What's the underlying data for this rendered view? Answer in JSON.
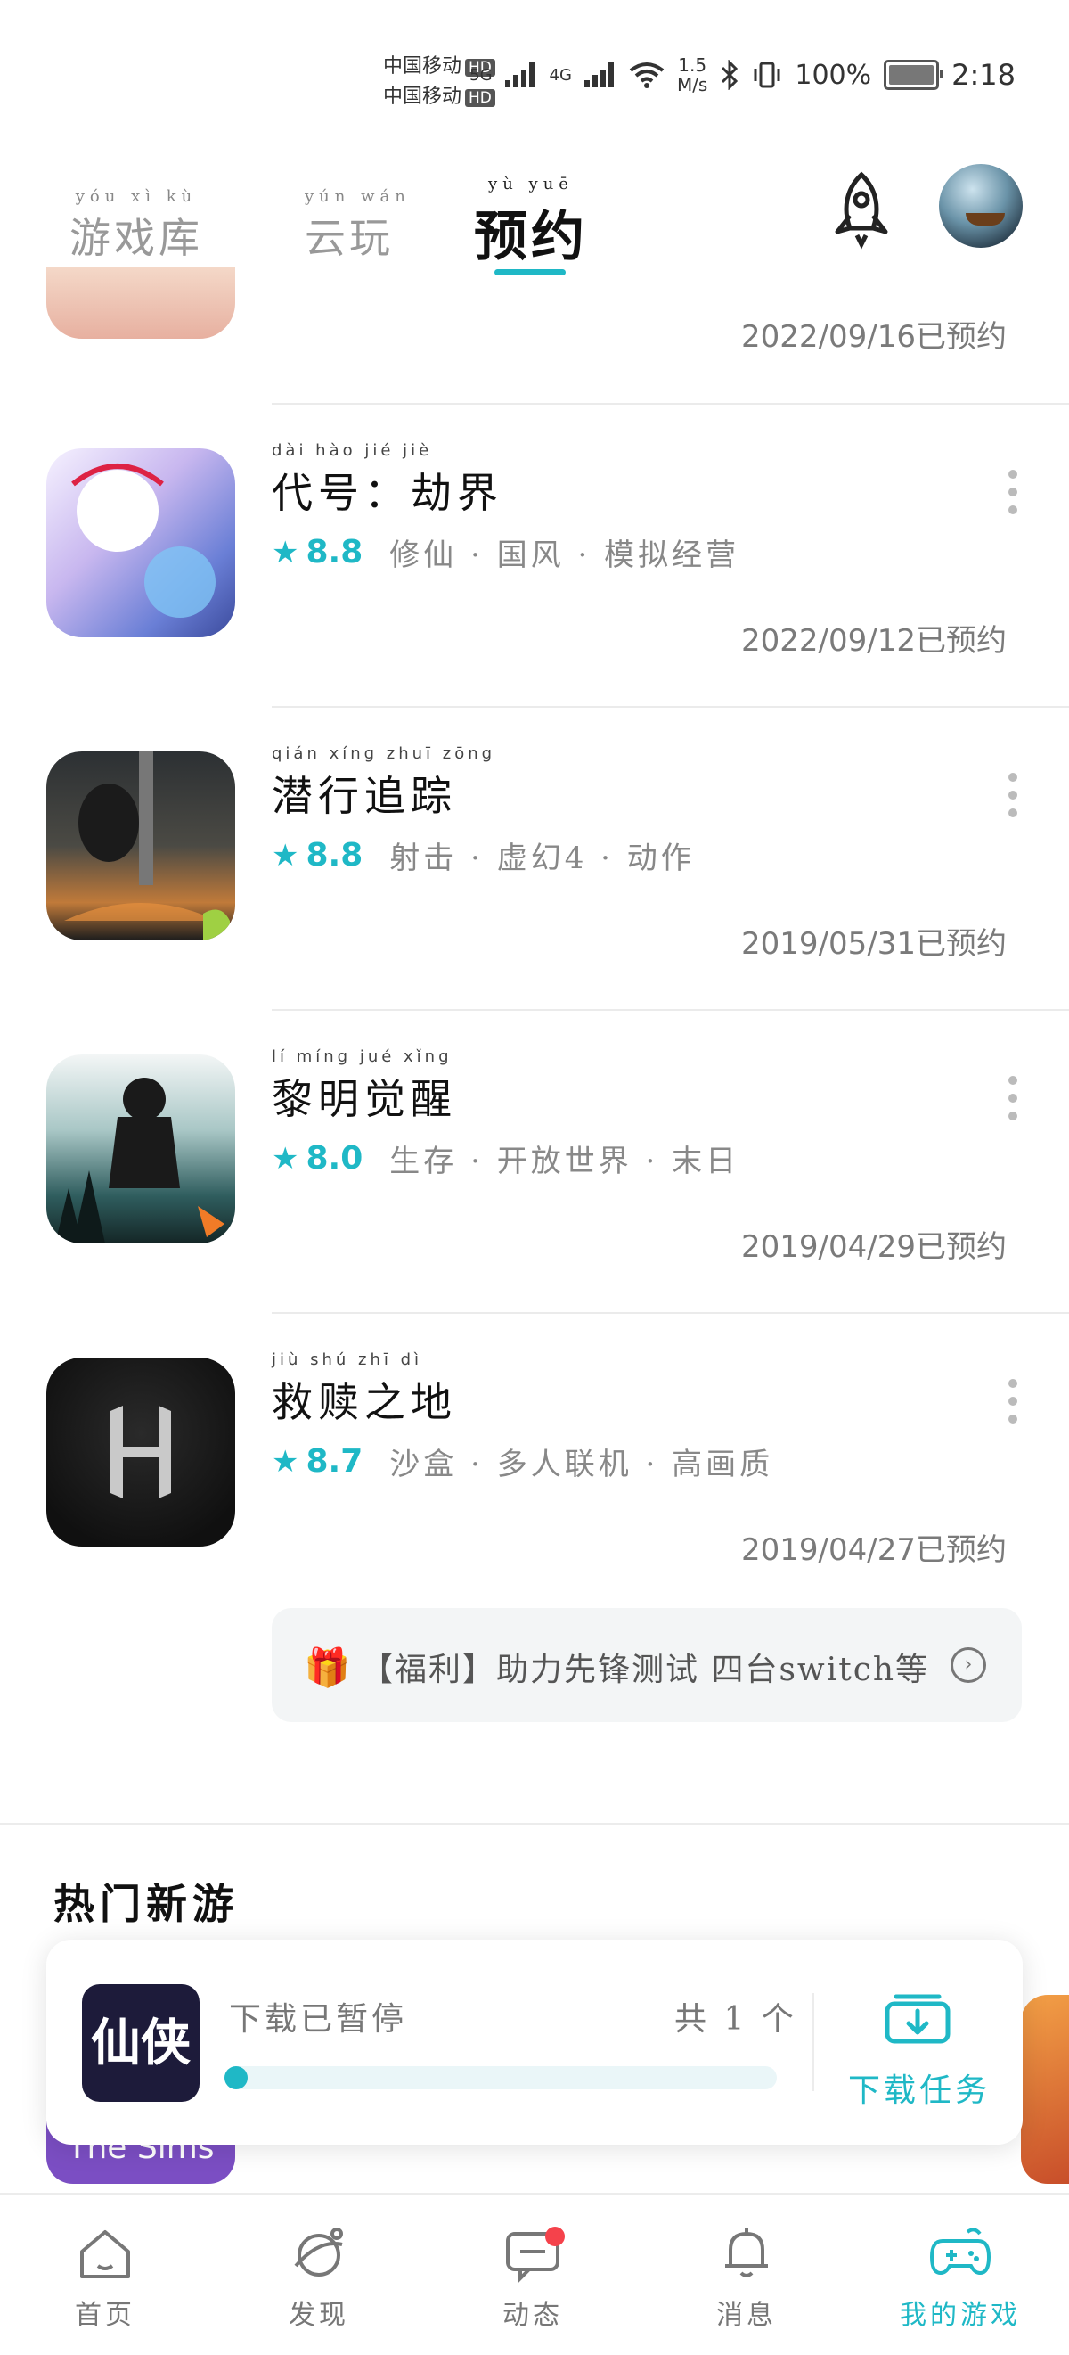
{
  "status_bar": {
    "carrier1": "中国移动",
    "carrier2": "中国移动",
    "hd": "HD",
    "net5g": "5G",
    "net4g": "4G",
    "speed_value": "1.5",
    "speed_unit": "M/s",
    "battery": "100%",
    "time": "2:18"
  },
  "top_nav": {
    "tabs": [
      {
        "label": "游戏库",
        "ruby": "yóu xì kù"
      },
      {
        "label": "云玩",
        "ruby": "yún wán"
      },
      {
        "label": "预约",
        "ruby": "yù yuē"
      }
    ],
    "active_tab": "预约",
    "accent": "#1fb8c6"
  },
  "partial_item": {
    "date": "2022/09/16已预约"
  },
  "reservations": [
    {
      "title": "代号：劫界",
      "ruby": "dài hào jié jiè",
      "score": "8.8",
      "tags": "修仙 · 国风 · 模拟经营",
      "date": "2022/09/12已预约"
    },
    {
      "title": "潜行追踪",
      "ruby": "qián xíng zhuī zōng",
      "score": "8.8",
      "tags": "射击 · 虚幻4 · 动作",
      "date": "2019/05/31已预约"
    },
    {
      "title": "黎明觉醒",
      "ruby": "lí míng jué xǐng",
      "score": "8.0",
      "tags": "生存 · 开放世界 · 末日",
      "date": "2019/04/29已预约"
    },
    {
      "title": "救赎之地",
      "ruby": "jiù shú zhī dì",
      "score": "8.7",
      "tags": "沙盒 · 多人联机 · 高画质",
      "date": "2019/04/27已预约"
    }
  ],
  "promo": {
    "text": "【福利】助力先锋测试 四台switch等"
  },
  "hot_section": {
    "title": "热门新游"
  },
  "behind": {
    "sims_label": "The Sims"
  },
  "download_card": {
    "icon_text": "仙侠",
    "status": "下载已暂停",
    "count": "共 1 个",
    "progress": 0.0,
    "task_label": "下载任务"
  },
  "bottom_nav": {
    "items": [
      {
        "label": "首页",
        "icon": "home-icon"
      },
      {
        "label": "发现",
        "icon": "discover-icon"
      },
      {
        "label": "动态",
        "icon": "chat-icon"
      },
      {
        "label": "消息",
        "icon": "bell-icon"
      },
      {
        "label": "我的游戏",
        "icon": "gamepad-icon"
      }
    ],
    "active": "我的游戏"
  }
}
